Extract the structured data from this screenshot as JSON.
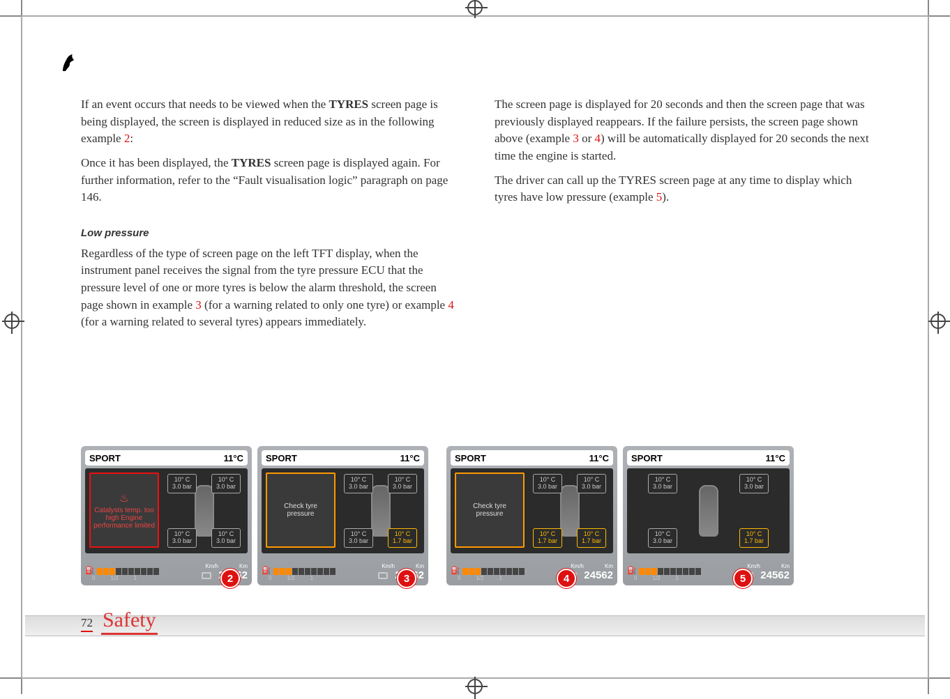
{
  "page": {
    "number": "72",
    "section": "Safety",
    "logo_alt": "Ferrari prancing horse"
  },
  "col_left": {
    "p1_pre": "If an event occurs that needs to be viewed when the ",
    "p1_bold": "TYRES",
    "p1_mid": " screen page is being displayed, the screen is displayed in reduced size as in the following example ",
    "p1_ex": "2",
    "p1_post": ":",
    "p2_pre": "Once it has been displayed, the ",
    "p2_bold": "TYRES",
    "p2_post": " screen page is displayed again. For further information, refer to the “Fault visualisation logic” paragraph on page 146.",
    "subhead": "Low pressure",
    "p3_pre": "Regardless of the type of screen page on the left TFT display, when the instrument panel receives the signal from the tyre pressure ECU that the pressure level of one or more tyres is below the alarm threshold, the screen page shown in example ",
    "p3_ex1": "3",
    "p3_mid": " (for a warning related to only one tyre) or example ",
    "p3_ex2": "4",
    "p3_post": " (for a warning related to several tyres) appears immediately."
  },
  "col_right": {
    "p1_pre": "The screen page is displayed for 20 seconds and then the screen page that was previously displayed reappears. If the failure persists, the screen page shown above (example ",
    "p1_ex1": "3",
    "p1_mid": " or ",
    "p1_ex2": "4",
    "p1_post": ") will be automatically displayed for 20 seconds the next time the engine is started.",
    "p2_pre": "The driver can call up the TYRES screen page at any time to display which tyres have low pressure (example ",
    "p2_ex": "5",
    "p2_post": ")."
  },
  "screen_common": {
    "mode": "SPORT",
    "temp": "11°C",
    "fuel_ticks": [
      "0",
      "1/2",
      "1"
    ],
    "kmh_label": "Km/h",
    "km_label": "Km",
    "odo": "24562"
  },
  "tyre_normal": {
    "t": "10° C",
    "p": "3.0 bar"
  },
  "tyre_low": {
    "t": "10° C",
    "p": "1.7 bar"
  },
  "screens": [
    {
      "id": "2",
      "warn_class": "warn-red",
      "warn_text": "Catalysts temp. too high Engine performance limited",
      "warn_icon": "♨",
      "tyres": {
        "fl": "n",
        "fr": "n",
        "rl": "n",
        "rr": "n"
      },
      "circ_left": "200"
    },
    {
      "id": "3",
      "warn_class": "warn-ora",
      "warn_text": "Check tyre pressure",
      "tyres": {
        "fl": "n",
        "fr": "n",
        "rl": "n",
        "rr": "l"
      },
      "circ_left": "200"
    },
    {
      "id": "4",
      "warn_class": "warn-ora",
      "warn_text": "Check tyre pressure",
      "tyres": {
        "fl": "n",
        "fr": "n",
        "rl": "l",
        "rr": "l"
      },
      "circ_left": "158"
    },
    {
      "id": "5",
      "warn_class": "",
      "warn_text": "",
      "tyres": {
        "fl": "n",
        "fr": "n",
        "rl": "n",
        "rr": "l"
      },
      "circ_left": "158"
    }
  ]
}
